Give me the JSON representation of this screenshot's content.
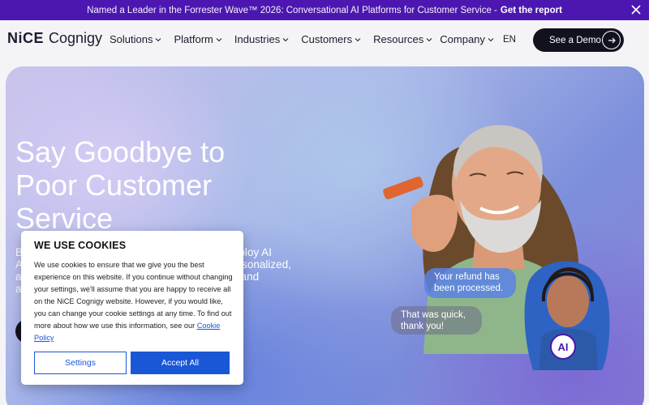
{
  "announcement": {
    "message": "Named a Leader in the Forrester Wave™ 2026: Conversational AI Platforms for Customer Service -",
    "cta": "Get the report",
    "close_icon": "close-icon"
  },
  "nav": {
    "logo_nice": "NiCE",
    "logo_cognigy": "Cognigy",
    "items": [
      {
        "label": "Solutions"
      },
      {
        "label": "Platform"
      },
      {
        "label": "Industries"
      },
      {
        "label": "Customers"
      },
      {
        "label": "Resources"
      },
      {
        "label": "Company"
      }
    ],
    "language": "EN",
    "demo_button": "See a Demo"
  },
  "hero": {
    "title": "Say Goodbye to Poor Customer Service",
    "body_visible": "B                                                                     eploy AI\nA                                                                     ersonalized,\na                                                                     d and\na",
    "bubble_refund": "Your refund has been processed.",
    "bubble_quick": "That was quick, thank you!",
    "ai_badge": "AI"
  },
  "cookie_dialog": {
    "title": "WE USE COOKIES",
    "body": "We use cookies to ensure that we give you the best experience on this website. If you continue without changing your settings, we'll assume that you are happy to receive all on the NiCE Cognigy website. However, if you would like, you can change your cookie settings at any time. To find out more about how we use this information, see our",
    "policy_link": "Cookie Policy",
    "settings_button": "Settings",
    "accept_button": "Accept All"
  },
  "colors": {
    "announcement_bg": "#4c17b0",
    "primary_blue": "#1a57d6",
    "dark_button": "#12121f"
  }
}
